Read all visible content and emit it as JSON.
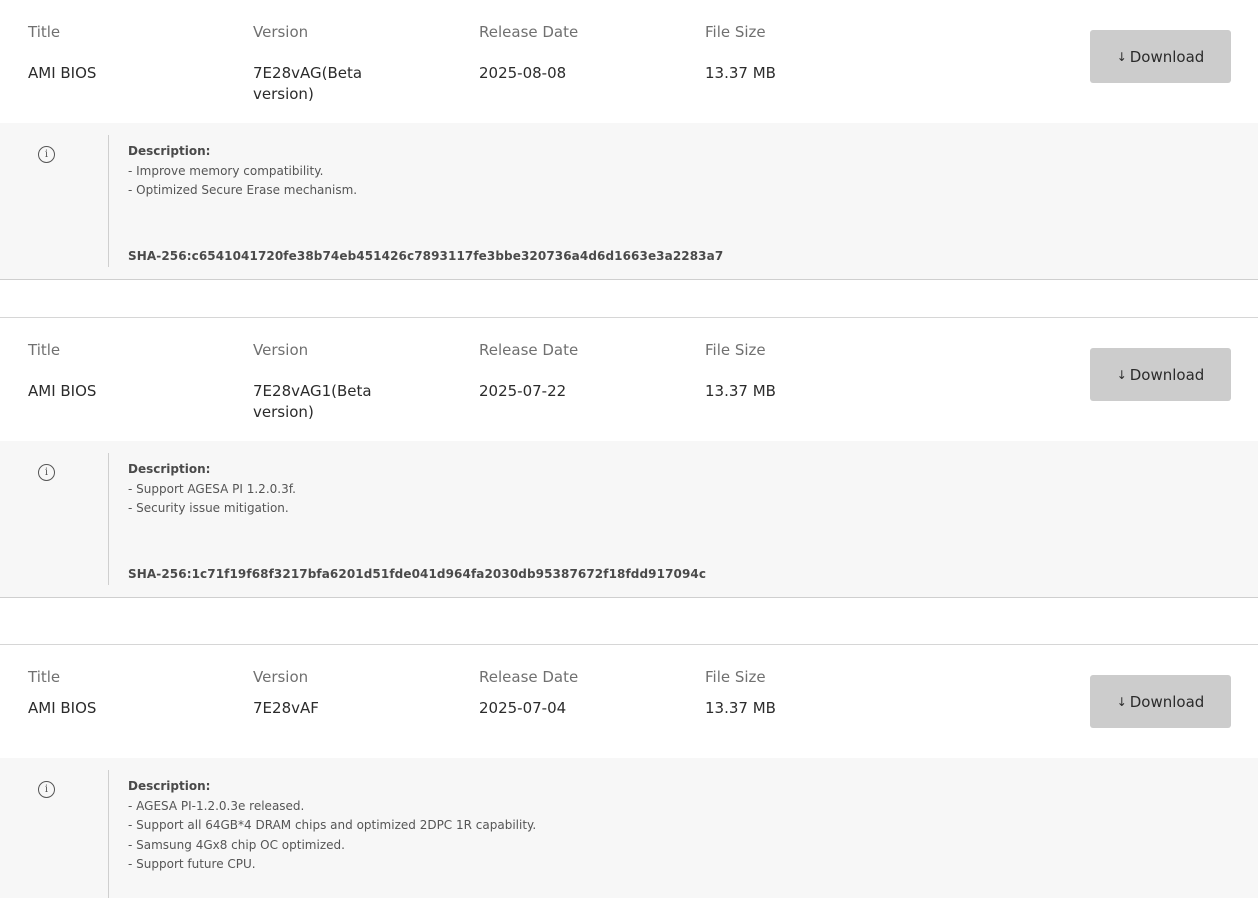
{
  "columns": {
    "title": "Title",
    "version": "Version",
    "release_date": "Release Date",
    "file_size": "File Size"
  },
  "download_label": "Download",
  "description_label": "Description:",
  "entries": [
    {
      "title": "AMI BIOS",
      "version": "7E28vAG(Beta version)",
      "release_date": "2025-08-08",
      "file_size": "13.37 MB",
      "description": [
        "- Improve memory compatibility.",
        "- Optimized Secure Erase mechanism."
      ],
      "sha": "SHA-256:c6541041720fe38b74eb451426c7893117fe3bbe320736a4d6d1663e3a2283a7"
    },
    {
      "title": "AMI BIOS",
      "version": "7E28vAG1(Beta version)",
      "release_date": "2025-07-22",
      "file_size": "13.37 MB",
      "description": [
        "- Support AGESA PI 1.2.0.3f.",
        "- Security issue mitigation."
      ],
      "sha": "SHA-256:1c71f19f68f3217bfa6201d51fde041d964fa2030db95387672f18fdd917094c"
    },
    {
      "title": "AMI BIOS",
      "version": "7E28vAF",
      "release_date": "2025-07-04",
      "file_size": "13.37 MB",
      "description": [
        "- AGESA PI-1.2.0.3e released.",
        "- Support all 64GB*4 DRAM chips and optimized 2DPC 1R capability.",
        "- Samsung 4Gx8 chip OC optimized.",
        "- Support future CPU."
      ],
      "sha": ""
    }
  ]
}
